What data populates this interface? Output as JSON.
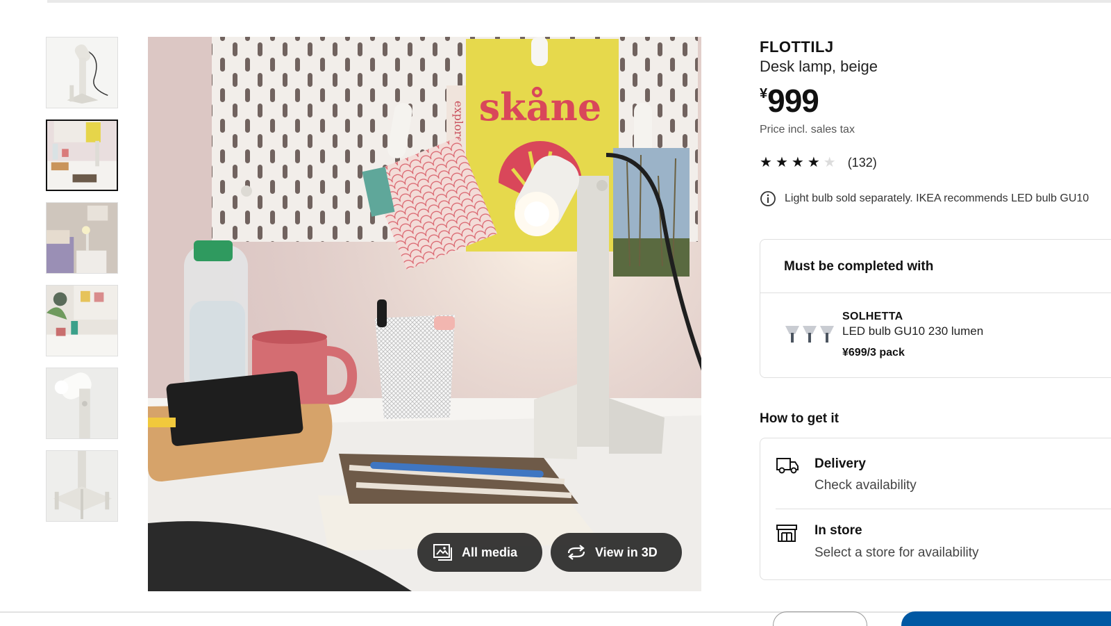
{
  "product": {
    "name": "FLOTTILJ",
    "description": "Desk lamp, beige",
    "price_currency": "¥",
    "price_value": "999",
    "tax_note": "Price incl. sales tax",
    "rating_value": 4,
    "rating_max": 5,
    "review_count": "(132)",
    "info_note": "Light bulb sold separately. IKEA recommends LED bulb GU10"
  },
  "gallery": {
    "thumbnails": [
      {
        "subject": "lamp-front-view"
      },
      {
        "subject": "lamp-on-desk-scene",
        "selected": true
      },
      {
        "subject": "bedroom-scene"
      },
      {
        "subject": "workspace-scene"
      },
      {
        "subject": "lamp-head-closeup"
      },
      {
        "subject": "lamp-base-closeup"
      }
    ],
    "hero_texts": {
      "card_title": "skåne",
      "card_side": "explorer",
      "card_top": "ex"
    },
    "buttons": {
      "all_media": "All media",
      "view_3d": "View in 3D"
    }
  },
  "complete_with": {
    "heading": "Must be completed with",
    "item": {
      "name": "SOLHETTA",
      "description": "LED bulb GU10 230 lumen",
      "price": "¥699/3 pack"
    }
  },
  "how_to_get": {
    "heading": "How to get it",
    "options": [
      {
        "title": "Delivery",
        "subtitle": "Check availability",
        "icon": "truck-icon"
      },
      {
        "title": "In store",
        "subtitle": "Select a store for availability",
        "icon": "store-icon"
      }
    ]
  },
  "colors": {
    "primary_button": "#0058a3",
    "overlay_button": "#111111",
    "border": "#dfdfdf"
  }
}
